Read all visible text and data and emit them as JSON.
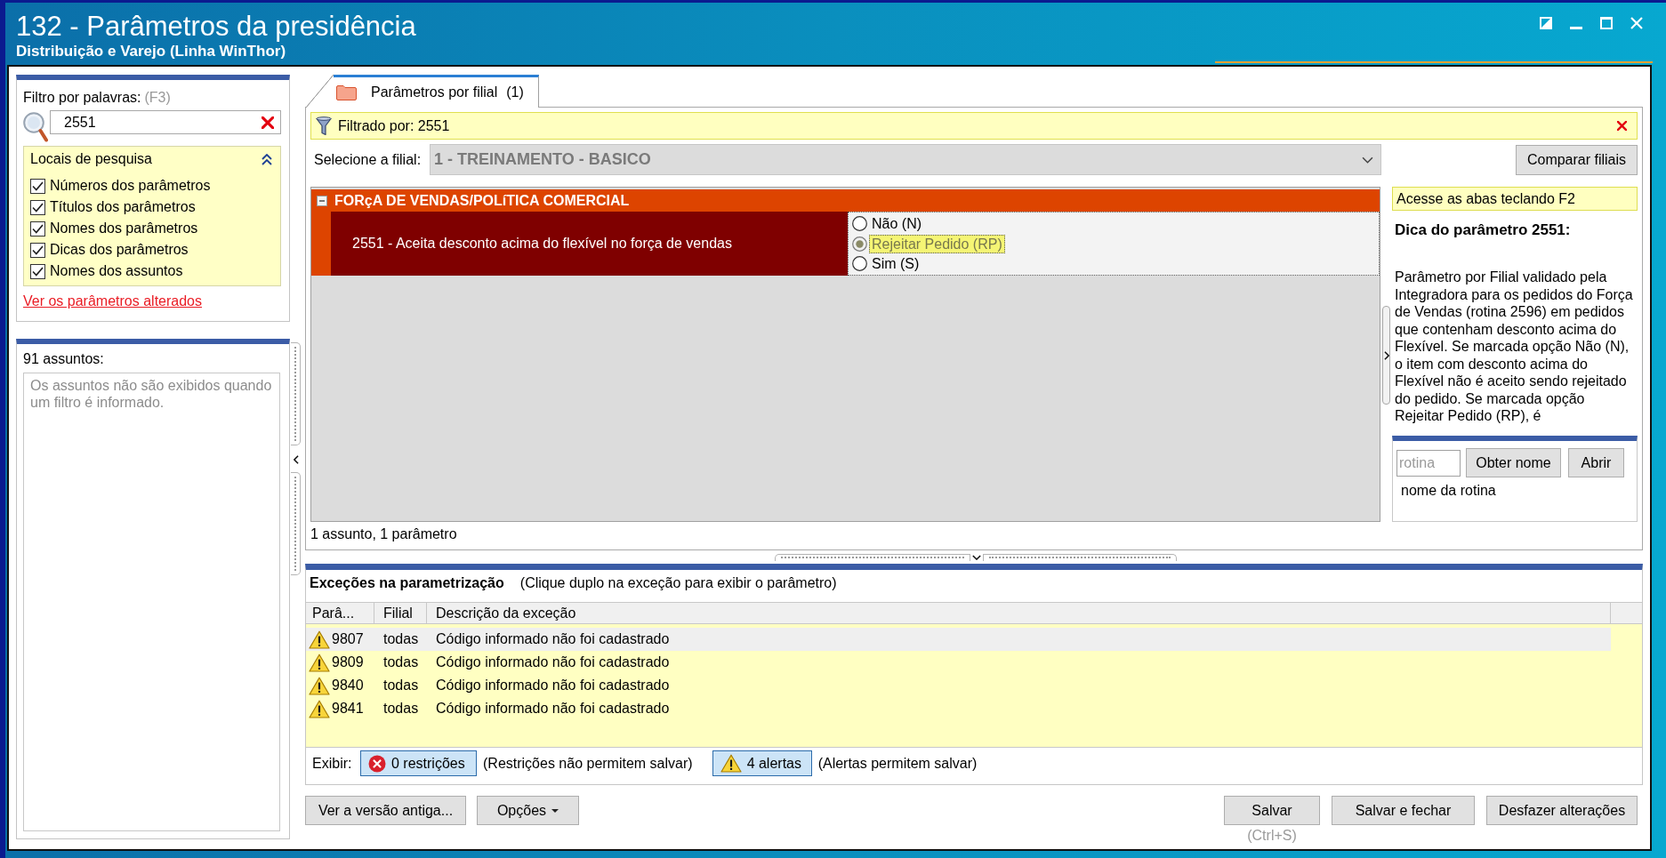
{
  "window": {
    "title": "132 - Parâmetros da presidência",
    "subtitle": "Distribuição e Varejo (Linha WinThor)"
  },
  "filter_panel": {
    "label": "Filtro por palavras:",
    "shortcut": "(F3)",
    "search": {
      "value": "2551"
    },
    "search_locations": {
      "title": "Locais de pesquisa",
      "expanded": true,
      "options": [
        {
          "label": "Números dos parâmetros",
          "checked": true
        },
        {
          "label": "Títulos dos parâmetros",
          "checked": true
        },
        {
          "label": "Nomes dos parâmetros",
          "checked": true
        },
        {
          "label": "Dicas dos parâmetros",
          "checked": true
        },
        {
          "label": "Nomes dos assuntos",
          "checked": true
        }
      ]
    },
    "link": "Ver os parâmetros alterados"
  },
  "subjects_panel": {
    "count": "91 assuntos:",
    "message": "Os assuntos não são exibidos quando um filtro é informado."
  },
  "tabs": [
    {
      "label": "Parâmetros por filial",
      "count": "(1)",
      "selected": true
    }
  ],
  "filter_bar": {
    "text": "Filtrado por: 2551"
  },
  "branch_select": {
    "label": "Selecione a filial:",
    "value": "1 - TREINAMENTO - BASICO",
    "disabled": true
  },
  "compare_button": "Comparar filiais",
  "groups": [
    {
      "title": "FORçA DE VENDAS/POLíTICA COMERCIAL",
      "expanded": true,
      "parameters": [
        {
          "title": "2551 - Aceita desconto acima do flexível no força de vendas",
          "options": [
            {
              "label": "Não (N)",
              "selected": false
            },
            {
              "label": "Rejeitar Pedido (RP)",
              "selected": true
            },
            {
              "label": "Sim (S)",
              "selected": false
            }
          ]
        }
      ]
    }
  ],
  "summary": "1 assunto, 1 parâmetro",
  "tip_panel": {
    "hint": "Acesse as abas teclando F2",
    "title": "Dica do parâmetro 2551:",
    "text": "Parâmetro por Filial validado pela Integradora para os pedidos do Força de Vendas (rotina 2596) em pedidos que contenham desconto acima do Flexível. Se marcada opção Não (N), o item com desconto acima do Flexível não é aceito sendo rejeitado do pedido. Se marcada opção Rejeitar Pedido (RP), é"
  },
  "routine_lookup": {
    "placeholder": "rotina",
    "buttons": [
      "Obter nome",
      "Abrir"
    ],
    "result": "nome da rotina"
  },
  "exceptions": {
    "title": "Exceções na parametrização",
    "hint": "(Clique duplo na exceção para exibir o parâmetro)",
    "columns": [
      "Parâ...",
      "Filial",
      "Descrição da exceção"
    ],
    "rows": [
      {
        "parameter": "9807",
        "branch": "todas",
        "description": "Código informado não foi cadastrado",
        "selected": true
      },
      {
        "parameter": "9809",
        "branch": "todas",
        "description": "Código informado não foi cadastrado",
        "selected": false
      },
      {
        "parameter": "9840",
        "branch": "todas",
        "description": "Código informado não foi cadastrado",
        "selected": false
      },
      {
        "parameter": "9841",
        "branch": "todas",
        "description": "Código informado não foi cadastrado",
        "selected": false
      }
    ],
    "show_label": "Exibir:",
    "filters": [
      {
        "kind": "restriction",
        "label": "0 restrições",
        "note": "(Restrições não permitem salvar)",
        "on": true
      },
      {
        "kind": "alert",
        "label": "4 alertas",
        "note": "(Alertas permitem salvar)",
        "on": true
      }
    ]
  },
  "footer": {
    "left_buttons": [
      {
        "kind": "plain",
        "label": "Ver a versão antiga..."
      },
      {
        "kind": "menu",
        "label": "Opções"
      }
    ],
    "right_buttons": [
      {
        "label": "Salvar",
        "shortcut": "(Ctrl+S)"
      },
      {
        "label": "Salvar e fechar"
      },
      {
        "label": "Desfazer alterações"
      }
    ]
  }
}
